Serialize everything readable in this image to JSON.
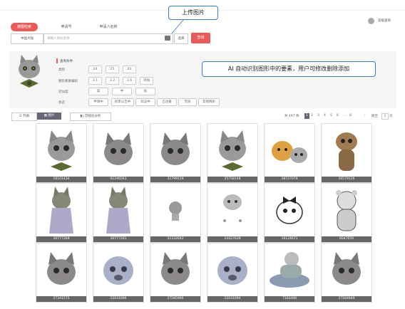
{
  "tabs": [
    {
      "label": "按图检索",
      "active": true
    },
    {
      "label": "申请号",
      "active": false
    },
    {
      "label": "申请人名称",
      "active": false
    }
  ],
  "advanced_search": "高级查询",
  "callout_upload": "上传图片",
  "callout_ai": "AI 自动识别图形中的要素，用户可修改删除添加",
  "search": {
    "country": "中国大陆",
    "placeholder": "请输入商标名称",
    "browse": "选择",
    "button": "查询"
  },
  "filters": {
    "title": "查询条件",
    "rows": [
      {
        "label": "类别",
        "values": [
          "24",
          "25",
          "43"
        ]
      },
      {
        "label": "图形要素编码",
        "values": [
          "3.1",
          "3.2",
          "3.6",
          "添加"
        ]
      },
      {
        "label": "近似度",
        "values": [
          "高",
          "中",
          "低"
        ]
      },
      {
        "label": "状态",
        "values": [
          "申请中",
          "初审公告中",
          "异议中",
          "已注册",
          "无效",
          "其他情形"
        ]
      }
    ]
  },
  "view": {
    "list": "列表",
    "grid": "图片",
    "analysis": "可视化分析"
  },
  "pagination": {
    "summary": "共 497 条",
    "pages": [
      "1",
      "2",
      "3",
      "4",
      "5",
      "6",
      "...",
      "8"
    ],
    "goto_label": "跳至",
    "goto_value": "1",
    "goto_unit": "页"
  },
  "results": [
    {
      "id": "16101434",
      "icon": "cat-bow-icon"
    },
    {
      "id": "01246563",
      "icon": "cat-icon"
    },
    {
      "id": "31799219",
      "icon": "cat-icon"
    },
    {
      "id": "25758148",
      "icon": "cat-bow-icon"
    },
    {
      "id": "28727079",
      "icon": "dog-cat-icon"
    },
    {
      "id": "20579126",
      "icon": "cat-standing-icon"
    },
    {
      "id": "30777269",
      "icon": "husky-icon"
    },
    {
      "id": "30777261",
      "icon": "husky-icon"
    },
    {
      "id": "31332642",
      "icon": "small-cat-icon"
    },
    {
      "id": "14427639",
      "icon": "cat-sketch-icon"
    },
    {
      "id": "16124671",
      "icon": "dog-bow-icon"
    },
    {
      "id": "6047659",
      "icon": "teddy-bear-icon"
    },
    {
      "id": "27341575",
      "icon": "cat-icon"
    },
    {
      "id": "22031096",
      "icon": "pug-icon"
    },
    {
      "id": "27585966",
      "icon": "cat-icon"
    },
    {
      "id": "22031094",
      "icon": "pug-icon"
    },
    {
      "id": "7163498",
      "icon": "bear-lying-icon"
    },
    {
      "id": "27504949",
      "icon": "cat-icon"
    }
  ]
}
